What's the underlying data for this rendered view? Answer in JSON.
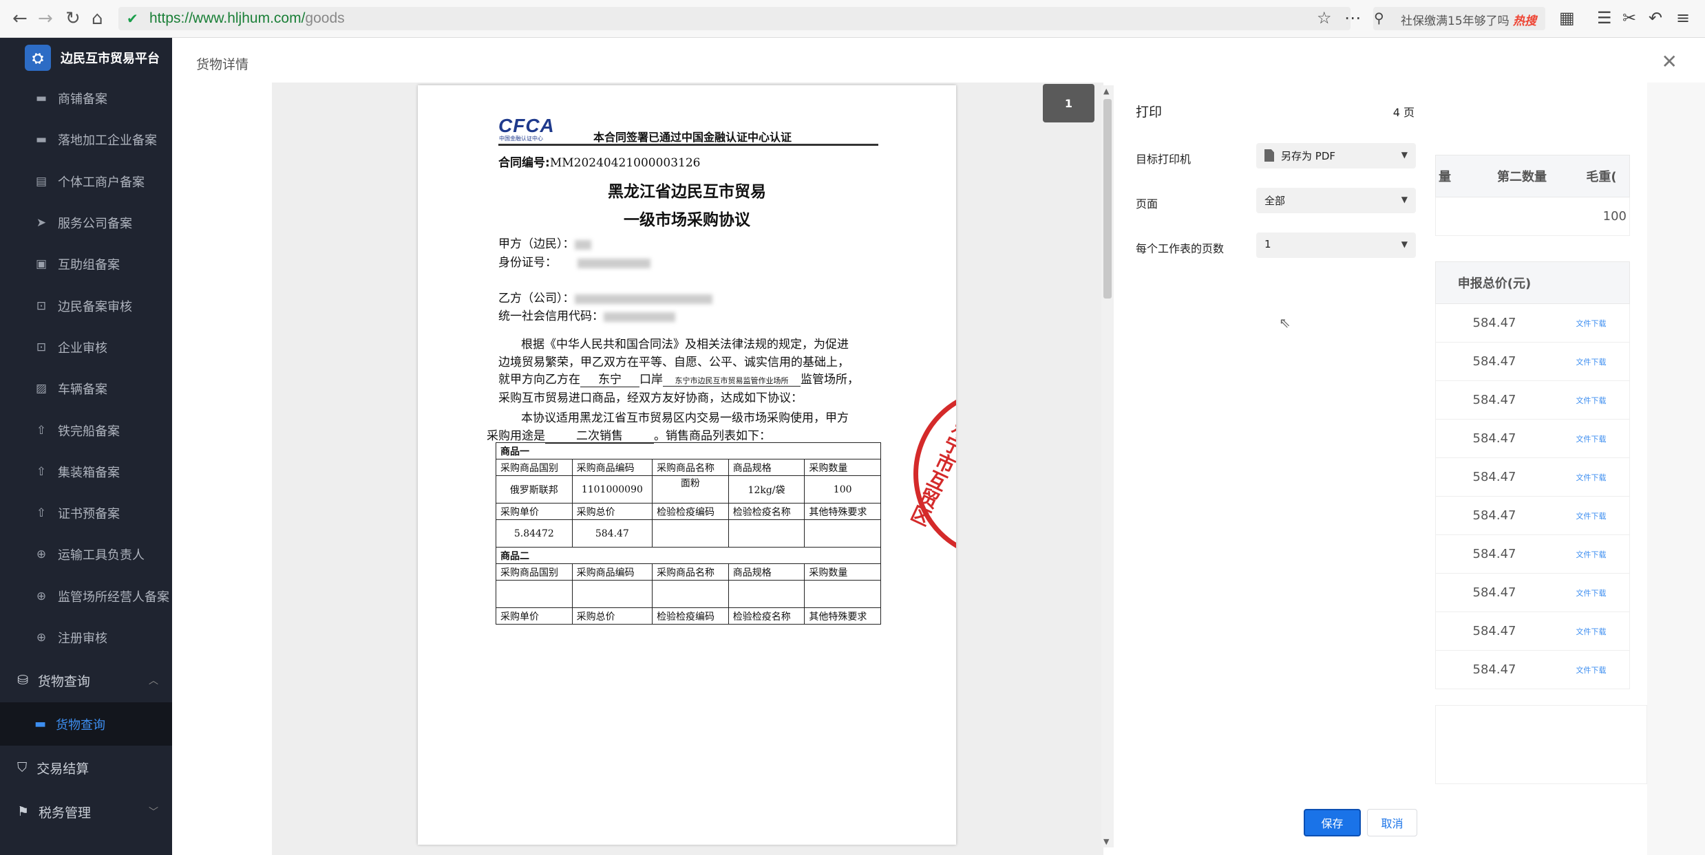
{
  "browser": {
    "url_host": "https://www.hljhum.com/",
    "url_path": "goods",
    "search_text": "社保缴满15年够了吗",
    "hot_label": "热搜"
  },
  "sidebar": {
    "brand": "边民互市贸易平台",
    "items": [
      {
        "label": "商铺备案",
        "icon": "store-icon"
      },
      {
        "label": "落地加工企业备案",
        "icon": "briefcase-icon"
      },
      {
        "label": "个体工商户备案",
        "icon": "clipboard-icon"
      },
      {
        "label": "服务公司备案",
        "icon": "send-icon"
      },
      {
        "label": "互助组备案",
        "icon": "gift-icon"
      },
      {
        "label": "边民备案审核",
        "icon": "lock-icon"
      },
      {
        "label": "企业审核",
        "icon": "lock-icon"
      },
      {
        "label": "车辆备案",
        "icon": "chart-icon"
      },
      {
        "label": "铁完船备案",
        "icon": "upload-icon"
      },
      {
        "label": "集装箱备案",
        "icon": "upload-icon"
      },
      {
        "label": "证书预备案",
        "icon": "upload-icon"
      },
      {
        "label": "运输工具负责人",
        "icon": "plus-circle-icon"
      },
      {
        "label": "监管场所经营人备案",
        "icon": "plus-circle-icon"
      },
      {
        "label": "注册审核",
        "icon": "plus-circle-icon"
      }
    ],
    "group_goods": "货物查询",
    "sub_goods": "货物查询",
    "group_trade": "交易结算",
    "group_tax": "税务管理"
  },
  "main": {
    "title": "货物详情",
    "table1_headers": [
      "量",
      "第二数量",
      "毛重("
    ],
    "table1_values": [
      "100"
    ],
    "table2_header": "申报总价(元)",
    "table2_values": [
      "584.47",
      "584.47",
      "584.47",
      "584.47",
      "584.47",
      "584.47",
      "584.47",
      "584.47",
      "584.47",
      "584.47"
    ],
    "download_label": "文件下载"
  },
  "preview": {
    "page_badge": "1",
    "cfca_logo": "CFCA",
    "cfca_sub": "中国金融认证中心",
    "cert_text": "本合同签署已通过中国金融认证中心认证",
    "contract_no_label": "合同编号:",
    "contract_no": "MM20240421000003126",
    "title_line1": "黑龙江省边民互市贸易",
    "title_line2": "一级市场采购协议",
    "party_a": "甲方（边民）：",
    "id_label": "身份证号：",
    "party_b": "乙方（公司）：",
    "credit_label": "统一社会信用代码：",
    "para1_l1": "根据《中华人民共和国合同法》及相关法律法规的规定，为促进",
    "para1_l2": "边境贸易繁荣，甲乙双方在平等、自愿、公平、诚实信用的基础上，",
    "para1_l3a": "就甲方向乙方在",
    "port": "东宁",
    "para1_l3b": "口岸",
    "site": "东宁市边民互市贸易监管作业场所",
    "para1_l3c": "监管场所，",
    "para1_l4": "采购互市贸易进口商品，经双方友好协商，达成如下协议：",
    "para2_l1": "本协议适用黑龙江省互市贸易区内交易一级市场采购使用，甲方",
    "para2_l2a": "采购用途是",
    "usage": "二次销售",
    "para2_l2b": "。销售商品列表如下：",
    "goods1_title": "商品一",
    "goods2_title": "商品二",
    "headers_a": [
      "采购商品国别",
      "采购商品编码",
      "采购商品名称",
      "商品规格",
      "采购数量"
    ],
    "headers_b": [
      "采购单价",
      "采购总价",
      "检验检疫编码",
      "检验检疫名称",
      "其他特殊要求"
    ],
    "goods1_row_a": [
      "俄罗斯联邦",
      "1101000090",
      "面粉",
      "12kg/袋",
      "100"
    ],
    "goods1_row_b": [
      "5.84472",
      "584.47",
      "",
      "",
      ""
    ],
    "seal_text": "东宁市互贸区"
  },
  "print": {
    "title": "打印",
    "page_count": "4 页",
    "printer_label": "目标打印机",
    "printer_value": "另存为 PDF",
    "pages_label": "页面",
    "pages_value": "全部",
    "per_sheet_label": "每个工作表的页数",
    "per_sheet_value": "1",
    "save_label": "保存",
    "cancel_label": "取消"
  }
}
